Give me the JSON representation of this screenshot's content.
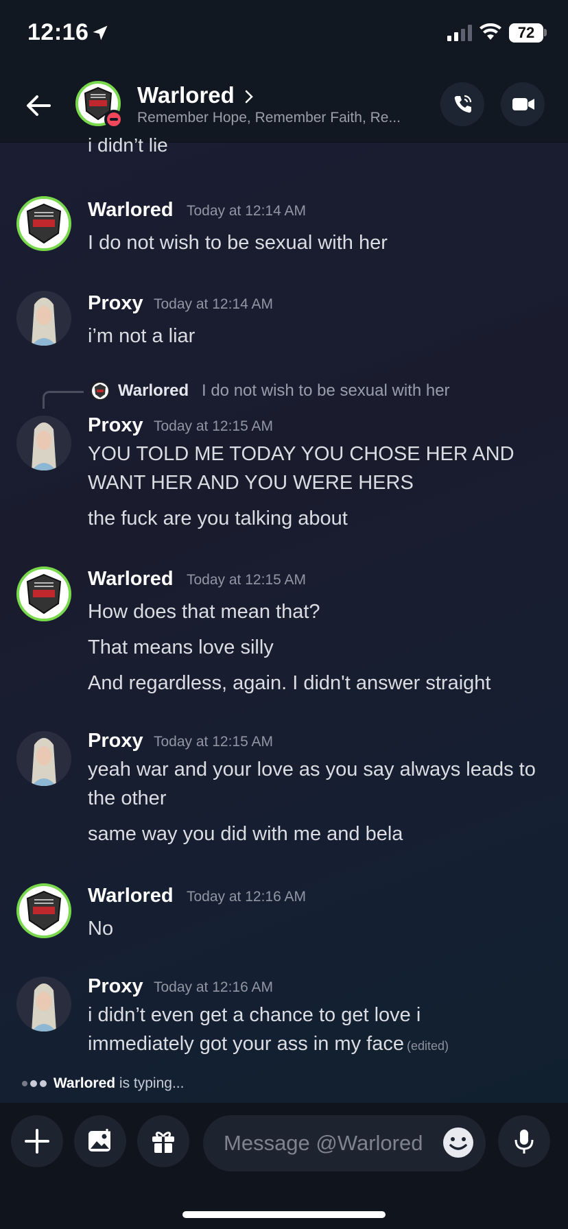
{
  "status_bar": {
    "time": "12:16",
    "battery": "72"
  },
  "header": {
    "name": "Warlored",
    "subtitle": "Remember Hope, Remember Faith, Re..."
  },
  "cut_text": "i didn’t lie",
  "messages": [
    {
      "author": "Warlored",
      "time": "Today at 12:14 AM",
      "lines": [
        "I do not wish to be sexual with her"
      ]
    },
    {
      "author": "Proxy",
      "time": "Today at 12:14 AM",
      "lines": [
        "i’m not a liar"
      ]
    },
    {
      "reply": {
        "author": "Warlored",
        "text": "I do not wish to be sexual with her"
      },
      "author": "Proxy",
      "time": "Today at 12:15 AM",
      "lines": [
        "YOU TOLD ME TODAY YOU CHOSE HER AND",
        "WANT HER AND YOU WERE HERS",
        "the fuck are you talking about"
      ]
    },
    {
      "author": "Warlored",
      "time": "Today at 12:15 AM",
      "lines": [
        "How does that mean that?",
        "That means love silly",
        "And regardless, again. I didn't answer straight"
      ]
    },
    {
      "author": "Proxy",
      "time": "Today at 12:15 AM",
      "lines": [
        "yeah war and your love as you say always leads to",
        "the other",
        "same way you did with me and bela"
      ]
    },
    {
      "author": "Warlored",
      "time": "Today at 12:16 AM",
      "lines": [
        "No"
      ]
    },
    {
      "author": "Proxy",
      "time": "Today at 12:16 AM",
      "lines": [
        "i didn’t even get a chance to get love i",
        "immediately got your ass in my face"
      ],
      "edited": "(edited)"
    }
  ],
  "typing": {
    "user": "Warlored",
    "text": "is typing..."
  },
  "composer": {
    "placeholder": "Message @Warlored"
  },
  "icons": {
    "back": "arrow-left-icon",
    "call": "phone-icon",
    "video": "video-camera-icon",
    "plus": "plus-icon",
    "image": "image-icon",
    "gift": "gift-icon",
    "emoji": "emoji-icon",
    "mic": "microphone-icon"
  },
  "colors": {
    "online_ring": "#79d94d",
    "dnd": "#f0475a",
    "background": "#1a1c2e"
  }
}
